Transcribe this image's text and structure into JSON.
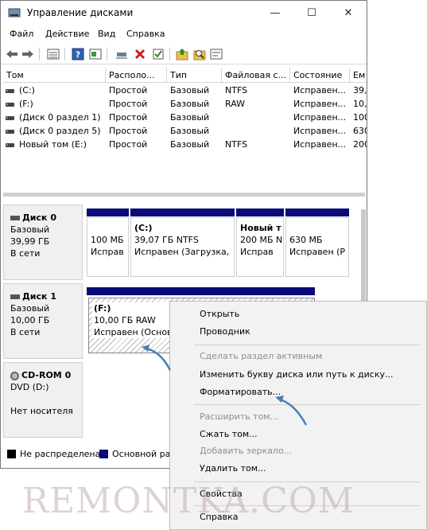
{
  "window": {
    "title": "Управление дисками"
  },
  "menu": [
    "Файл",
    "Действие",
    "Вид",
    "Справка"
  ],
  "toolbar": {
    "icons": [
      "back-arrow-icon",
      "forward-arrow-icon",
      "list-view-icon",
      "help-icon",
      "console-icon",
      "connect-icon",
      "delete-icon",
      "properties-icon",
      "open-folder-icon",
      "search-icon",
      "settings-icon"
    ]
  },
  "volume_list": {
    "columns": [
      "Том",
      "Располо...",
      "Тип",
      "Файловая с...",
      "Состояние",
      "Ем"
    ],
    "rows": [
      [
        "(C:)",
        "Простой",
        "Базовый",
        "NTFS",
        "Исправен...",
        "39,"
      ],
      [
        "(F:)",
        "Простой",
        "Базовый",
        "RAW",
        "Исправен...",
        "10,"
      ],
      [
        "(Диск 0 раздел 1)",
        "Простой",
        "Базовый",
        "",
        "Исправен...",
        "100"
      ],
      [
        "(Диск 0 раздел 5)",
        "Простой",
        "Базовый",
        "",
        "Исправен...",
        "630"
      ],
      [
        "Новый том (E:)",
        "Простой",
        "Базовый",
        "NTFS",
        "Исправен...",
        "200"
      ]
    ]
  },
  "disks": [
    {
      "name": "Диск 0",
      "type": "Базовый",
      "size": "39,99 ГБ",
      "status": "В сети",
      "partitions": [
        {
          "line1": "",
          "line2": "100 МБ",
          "line3": "Исправ"
        },
        {
          "line1": "(C:)",
          "line2": "39,07 ГБ NTFS",
          "line3": "Исправен (Загрузка,"
        },
        {
          "line1": "Новый т",
          "line2": "200 МБ N",
          "line3": "Исправ"
        },
        {
          "line1": "",
          "line2": "630 МБ",
          "line3": "Исправен (Р"
        }
      ]
    },
    {
      "name": "Диск 1",
      "type": "Базовый",
      "size": "10,00 ГБ",
      "status": "В сети",
      "partitions": [
        {
          "line1": "(F:)",
          "line2": "10,00 ГБ RAW",
          "line3": "Исправен (Основ"
        }
      ]
    },
    {
      "name": "CD-ROM 0",
      "type": "DVD (D:)",
      "size": "",
      "status": "Нет носителя",
      "partitions": []
    }
  ],
  "legend": [
    {
      "label": "Не распределена",
      "color": "#000000"
    },
    {
      "label": "Основной ра",
      "color": "#0a0a78"
    }
  ],
  "context_menu": [
    {
      "label": "Открыть",
      "enabled": true
    },
    {
      "label": "Проводник",
      "enabled": true
    },
    {
      "label": "Сделать раздел активным",
      "enabled": false
    },
    {
      "label": "Изменить букву диска или путь к диску...",
      "enabled": true
    },
    {
      "label": "Форматировать...",
      "enabled": true
    },
    {
      "label": "Расширить том...",
      "enabled": false
    },
    {
      "label": "Сжать том...",
      "enabled": true
    },
    {
      "label": "Добавить зеркало...",
      "enabled": false
    },
    {
      "label": "Удалить том...",
      "enabled": true
    },
    {
      "label": "Свойства",
      "enabled": true
    },
    {
      "label": "Справка",
      "enabled": true
    }
  ],
  "watermark": "REMONTKA.COM",
  "colors": {
    "partition_header": "#0a0a78",
    "annotation_arrow": "#4a7fb5",
    "unallocated": "#000000"
  }
}
